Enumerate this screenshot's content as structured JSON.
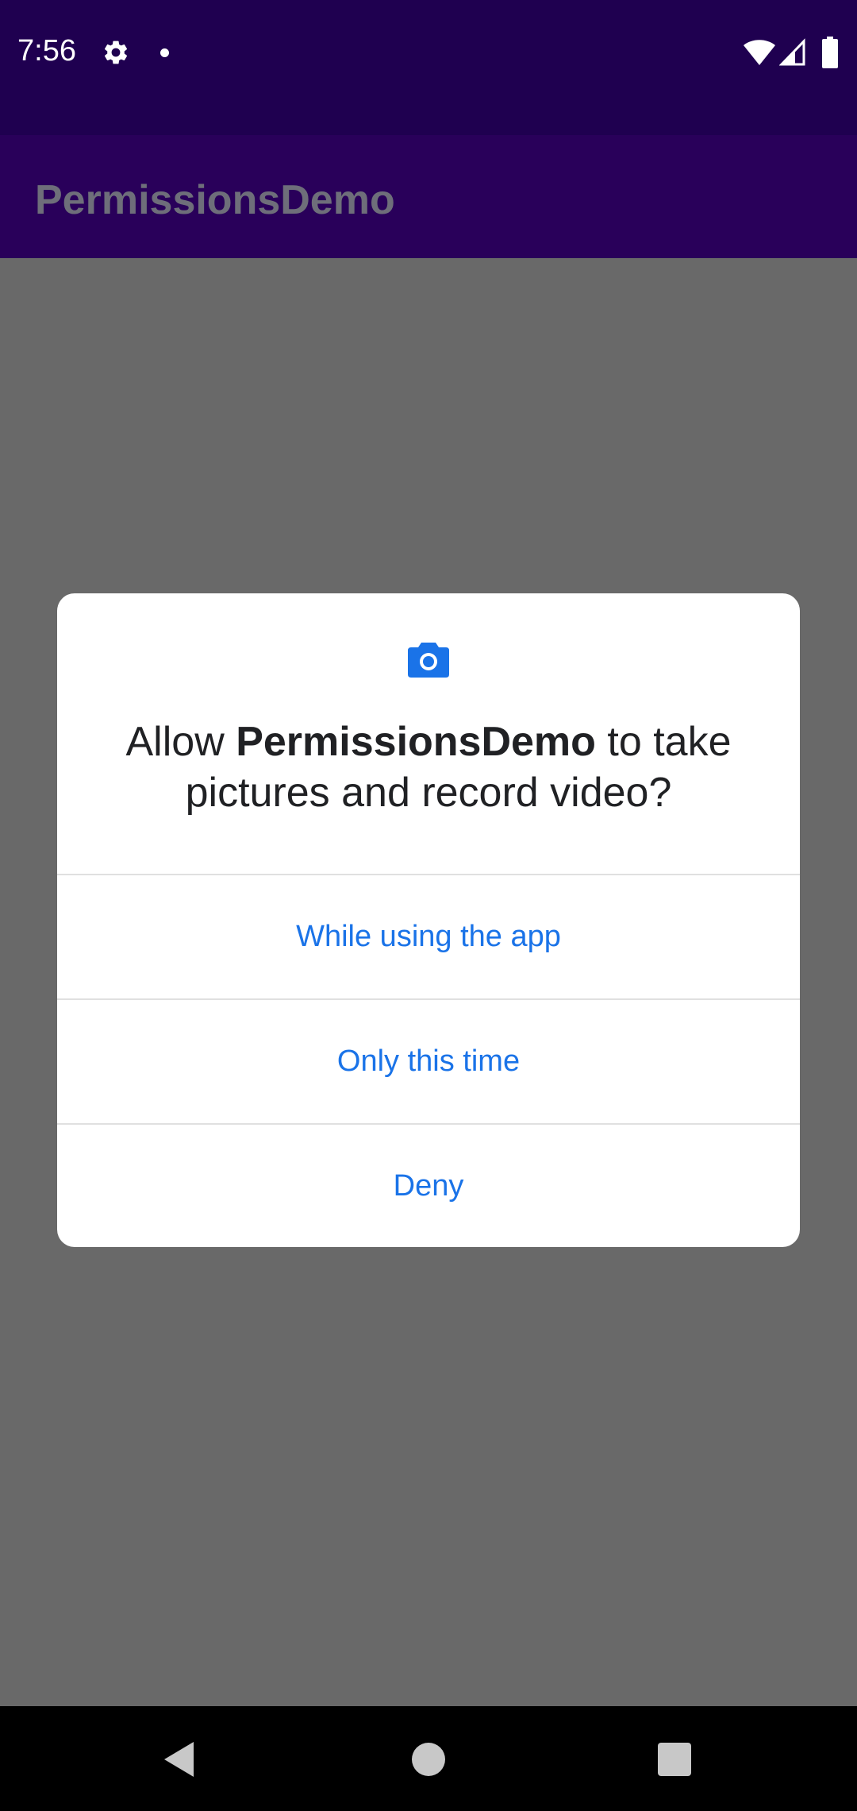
{
  "status_bar": {
    "time": "7:56",
    "icons": [
      "gear-icon",
      "notification-dot-icon",
      "wifi-icon",
      "signal-icon",
      "battery-icon"
    ]
  },
  "app_bar": {
    "title": "PermissionsDemo"
  },
  "dialog": {
    "icon": "camera-icon",
    "message_prefix": "Allow ",
    "app_name": "PermissionsDemo",
    "message_suffix": " to take pictures and record video?",
    "buttons": [
      {
        "label": "While using the app"
      },
      {
        "label": "Only this time"
      },
      {
        "label": "Deny"
      }
    ]
  },
  "nav_bar": {
    "icons": [
      "back-icon",
      "home-icon",
      "recents-icon"
    ]
  },
  "colors": {
    "status_bar": "#1f0050",
    "app_bar": "#29005a",
    "scrim": "#696969",
    "accent": "#1a73e8",
    "dialog_background": "#ffffff"
  }
}
